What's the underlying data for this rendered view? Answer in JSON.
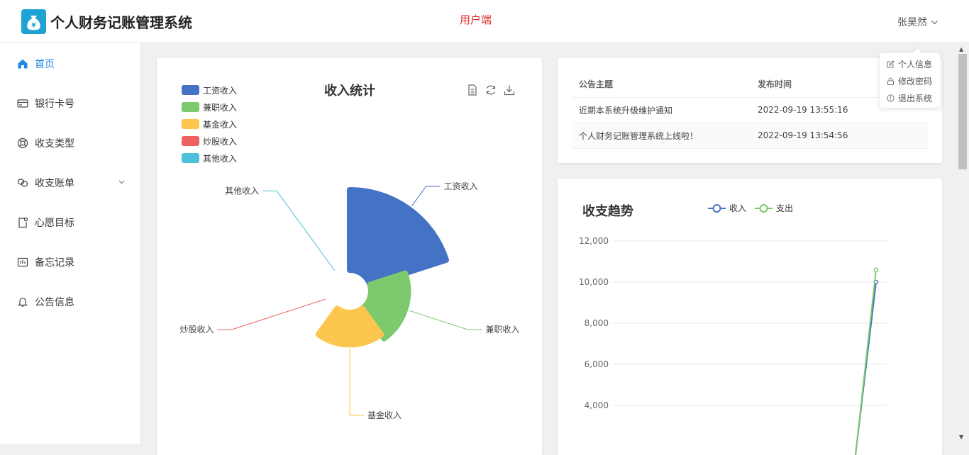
{
  "header": {
    "app_title": "个人财务记账管理系统",
    "portal_label": "用户端",
    "user_name": "张昊然"
  },
  "user_dropdown": {
    "items": [
      "个人信息",
      "修改密码",
      "退出系统"
    ]
  },
  "sidebar": {
    "items": [
      {
        "label": "首页",
        "icon": "home-icon"
      },
      {
        "label": "银行卡号",
        "icon": "card-icon"
      },
      {
        "label": "收支类型",
        "icon": "lifebuoy-icon"
      },
      {
        "label": "收支账单",
        "icon": "link-icon"
      },
      {
        "label": "心愿目标",
        "icon": "wish-icon"
      },
      {
        "label": "备忘记录",
        "icon": "memo-icon"
      },
      {
        "label": "公告信息",
        "icon": "bell-icon"
      }
    ]
  },
  "notice": {
    "headers": [
      "公告主题",
      "发布时间"
    ],
    "rows": [
      [
        "近期本系统升级维护通知",
        "2022-09-19 13:55:16"
      ],
      [
        "个人财务记账管理系统上线啦！",
        "2022-09-19 13:54:56"
      ]
    ]
  },
  "colors": {
    "accent": "#1e88e5",
    "portal": "#e03030",
    "salary": "#4472c4",
    "parttime": "#7cc96e",
    "fund": "#fcc64f",
    "stock": "#f06060",
    "other": "#4ec0d9"
  },
  "chart_data": [
    {
      "type": "pie",
      "subtype": "rose",
      "title": "收入统计",
      "legend": [
        "工资收入",
        "兼职收入",
        "基金收入",
        "炒股收入",
        "其他收入"
      ],
      "categories": [
        "工资收入",
        "兼职收入",
        "基金收入",
        "炒股收入",
        "其他收入"
      ],
      "values": [
        10000,
        1500,
        1000,
        0,
        0
      ],
      "legend_position": "top-left"
    },
    {
      "type": "line",
      "title": "收支趋势",
      "legend": [
        "收入",
        "支出"
      ],
      "yticks": [
        "12,000",
        "10,000",
        "8,000",
        "6,000",
        "4,000"
      ],
      "ylim": [
        0,
        12000
      ],
      "series": [
        {
          "name": "收入",
          "values": [
            10000
          ]
        },
        {
          "name": "支出",
          "values": [
            10600
          ]
        }
      ],
      "grid": true,
      "legend_position": "top"
    }
  ]
}
